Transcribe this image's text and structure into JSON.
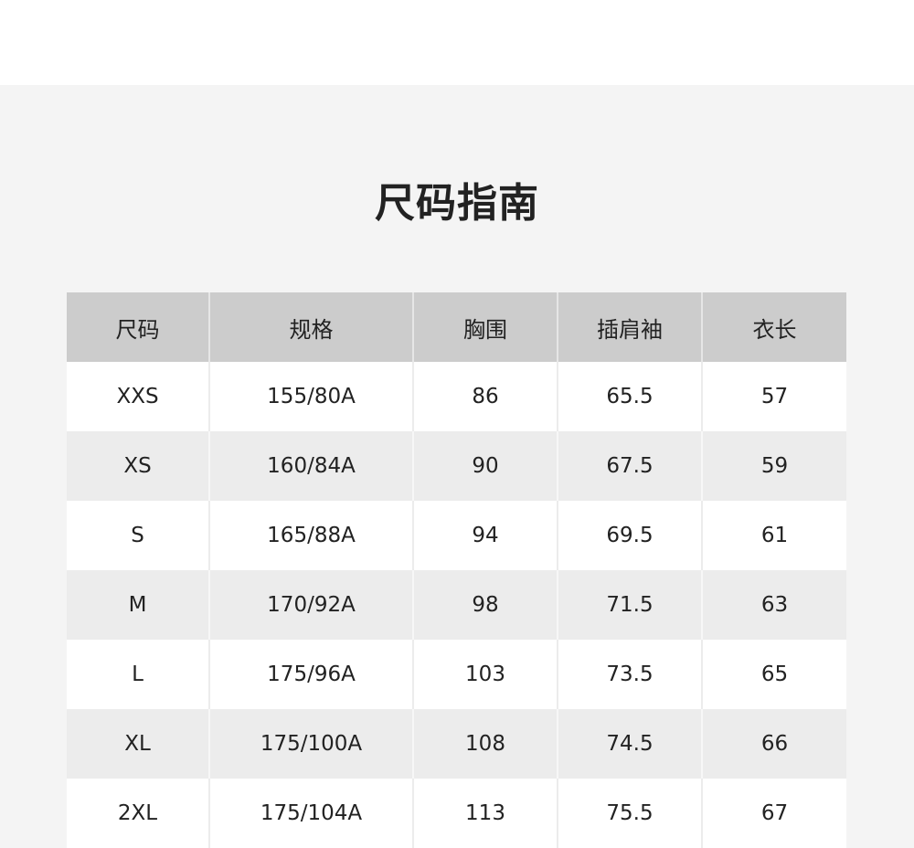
{
  "title": "尺码指南",
  "table": {
    "headers": [
      "尺码",
      "规格",
      "胸围",
      "插肩袖",
      "衣长"
    ],
    "rows": [
      [
        "XXS",
        "155/80A",
        "86",
        "65.5",
        "57"
      ],
      [
        "XS",
        "160/84A",
        "90",
        "67.5",
        "59"
      ],
      [
        "S",
        "165/88A",
        "94",
        "69.5",
        "61"
      ],
      [
        "M",
        "170/92A",
        "98",
        "71.5",
        "63"
      ],
      [
        "L",
        "175/96A",
        "103",
        "73.5",
        "65"
      ],
      [
        "XL",
        "175/100A",
        "108",
        "74.5",
        "66"
      ],
      [
        "2XL",
        "175/104A",
        "113",
        "75.5",
        "67"
      ]
    ]
  }
}
